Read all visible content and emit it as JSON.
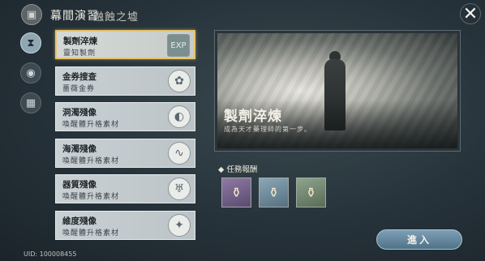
{
  "header": {
    "title": "幕間演習",
    "subtitle": "融蝕之墟",
    "close_icon": "close-icon"
  },
  "side_nav": [
    {
      "icon": "dna-icon",
      "active": true
    },
    {
      "icon": "eye-icon",
      "active": false
    },
    {
      "icon": "calendar-icon",
      "active": false
    }
  ],
  "list": [
    {
      "name": "製劑淬煉",
      "sub": "靈知製劑",
      "icon": "potion-icon",
      "selected": true
    },
    {
      "name": "金券搜查",
      "sub": "薔薇金券",
      "icon": "coin-icon",
      "selected": false
    },
    {
      "name": "洞濁殘像",
      "sub": "喚醒體升格素材",
      "icon": "mask-icon",
      "selected": false
    },
    {
      "name": "海濁殘像",
      "sub": "喚醒體升格素材",
      "icon": "wave-icon",
      "selected": false
    },
    {
      "name": "器質殘像",
      "sub": "喚醒體升格素材",
      "icon": "jaw-icon",
      "selected": false
    },
    {
      "name": "維度殘像",
      "sub": "喚醒體升格素材",
      "icon": "star-icon",
      "selected": false
    }
  ],
  "banner": {
    "title": "製劑淬煉",
    "description": "成為天才藥理師的第一步。"
  },
  "rewards": {
    "heading": "◆ 任務報酬",
    "items": [
      {
        "icon": "potion-purple-icon",
        "rarity_color": "#6b5a82"
      },
      {
        "icon": "potion-blue-icon",
        "rarity_color": "#627d8d"
      },
      {
        "icon": "potion-green-icon",
        "rarity_color": "#627660"
      }
    ]
  },
  "enter_button": {
    "label": "進入"
  },
  "uid": {
    "label": "UID: 100008455"
  },
  "colors": {
    "accent": "#e7c36b",
    "button": "#6a8da3"
  }
}
